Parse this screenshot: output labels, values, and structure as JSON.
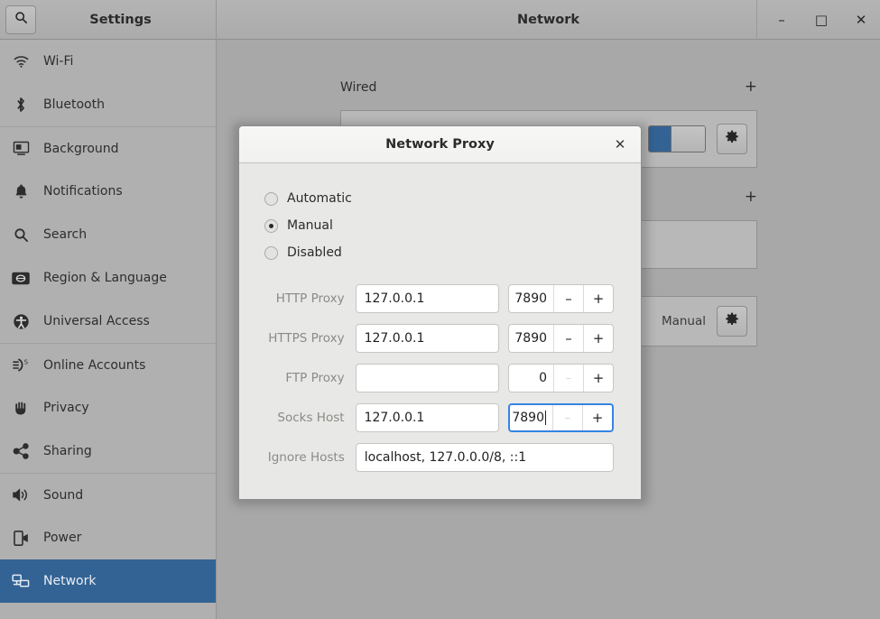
{
  "window": {
    "sidebar_title": "Settings",
    "title": "Network",
    "search_icon": "search-icon",
    "controls": {
      "minimize": "–",
      "maximize": "□",
      "close": "✕"
    }
  },
  "sidebar": {
    "items": [
      {
        "label": "Wi-Fi",
        "icon": "wifi-icon",
        "active": false,
        "separator": false
      },
      {
        "label": "Bluetooth",
        "icon": "bluetooth-icon",
        "active": false,
        "separator": false
      },
      {
        "label": "Background",
        "icon": "background-icon",
        "active": false,
        "separator": true
      },
      {
        "label": "Notifications",
        "icon": "bell-icon",
        "active": false,
        "separator": false
      },
      {
        "label": "Search",
        "icon": "search-icon",
        "active": false,
        "separator": false
      },
      {
        "label": "Region & Language",
        "icon": "region-language-icon",
        "active": false,
        "separator": false
      },
      {
        "label": "Universal Access",
        "icon": "universal-access-icon",
        "active": false,
        "separator": false
      },
      {
        "label": "Online Accounts",
        "icon": "online-accounts-icon",
        "active": false,
        "separator": true
      },
      {
        "label": "Privacy",
        "icon": "privacy-hand-icon",
        "active": false,
        "separator": false
      },
      {
        "label": "Sharing",
        "icon": "sharing-icon",
        "active": false,
        "separator": false
      },
      {
        "label": "Sound",
        "icon": "speaker-icon",
        "active": true,
        "separator": true
      },
      {
        "label": "Power",
        "icon": "power-icon",
        "active": false,
        "separator": false
      },
      {
        "label": "Network",
        "icon": "network-icon",
        "active": true,
        "separator": false
      }
    ]
  },
  "network_page": {
    "sections": [
      {
        "title": "Wired",
        "add_label": "+",
        "row_value": "",
        "has_toggle": true,
        "has_gear": true
      },
      {
        "title": "",
        "add_label": "+",
        "row_value": "",
        "has_toggle": false,
        "has_gear": false
      },
      {
        "title": "",
        "add_label": "",
        "row_value": "Manual",
        "has_toggle": false,
        "has_gear": true
      }
    ]
  },
  "dialog": {
    "title": "Network Proxy",
    "close_label": "✕",
    "proxy_modes": [
      {
        "label": "Automatic",
        "checked": false
      },
      {
        "label": "Manual",
        "checked": true
      },
      {
        "label": "Disabled",
        "checked": false
      }
    ],
    "fields": [
      {
        "label": "HTTP Proxy",
        "host": "127.0.0.1",
        "port": "7890",
        "port_focused": false,
        "minus_enabled": true,
        "minus": "–",
        "plus": "+"
      },
      {
        "label": "HTTPS Proxy",
        "host": "127.0.0.1",
        "port": "7890",
        "port_focused": false,
        "minus_enabled": true,
        "minus": "–",
        "plus": "+"
      },
      {
        "label": "FTP Proxy",
        "host": "",
        "port": "0",
        "port_focused": false,
        "minus_enabled": false,
        "minus": "–",
        "plus": "+"
      },
      {
        "label": "Socks Host",
        "host": "127.0.0.1",
        "port": "7890",
        "port_focused": true,
        "minus_enabled": false,
        "minus": "–",
        "plus": "+"
      }
    ],
    "ignore_hosts": {
      "label": "Ignore Hosts",
      "value": "localhost, 127.0.0.0/8, ::1"
    }
  },
  "colors": {
    "accent": "#336394",
    "focus": "#3584e4",
    "sidebar_bg": "#b0b0b0",
    "content_bg": "#a8a8a8",
    "dialog_bg": "#e8e8e6"
  }
}
